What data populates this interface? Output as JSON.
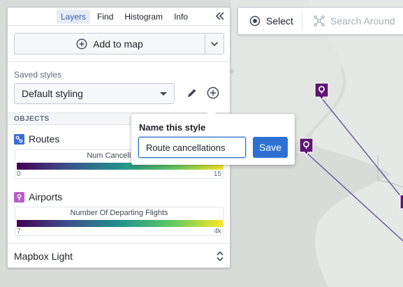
{
  "panel": {
    "tabs": [
      "Layers",
      "Find",
      "Histogram",
      "Info"
    ],
    "active_tab": "Layers",
    "add_to_map_label": "Add to map",
    "saved_styles_label": "Saved styles",
    "selected_style": "Default styling",
    "objects_header": "OBJECTS",
    "objects": [
      {
        "name": "Routes",
        "icon": "route-icon",
        "icon_color": "#3d6cd6",
        "legend_title": "Num Cancellations",
        "legend_min": "0",
        "legend_max": "15"
      },
      {
        "name": "Airports",
        "icon": "map-pin-icon",
        "icon_color": "#b55fc7",
        "legend_title": "Number Of Departing Flights",
        "legend_min": "7",
        "legend_max": "4k"
      }
    ],
    "basemap": "Mapbox Light"
  },
  "popover": {
    "title": "Name this style",
    "input_value": "Route cancellations",
    "save_label": "Save"
  },
  "toolbar": {
    "select_label": "Select",
    "search_around_label": "Search Around"
  },
  "colors": {
    "accent": "#2d72d2",
    "pin": "#5c1670",
    "route": "#6b5b95"
  }
}
